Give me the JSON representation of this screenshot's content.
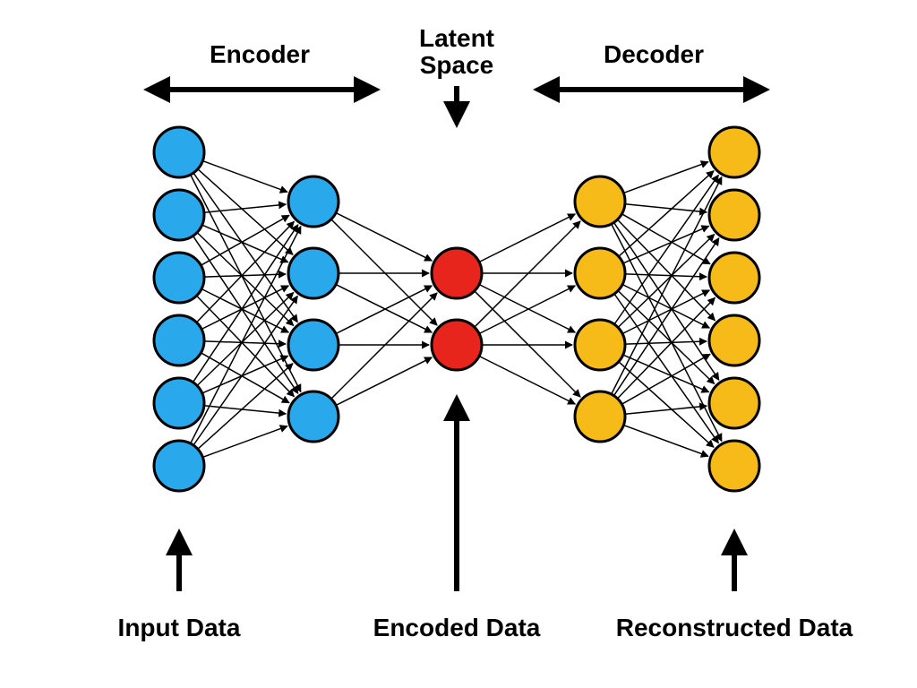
{
  "labels": {
    "encoder": "Encoder",
    "latent_space_line1": "Latent",
    "latent_space_line2": "Space",
    "decoder": "Decoder",
    "input_data": "Input Data",
    "encoded_data": "Encoded Data",
    "reconstructed_data": "Reconstructed Data"
  },
  "colors": {
    "encoder_node": "#2aa8ec",
    "latent_node": "#e8251c",
    "decoder_node": "#f6bb18",
    "arrow": "#000000"
  },
  "architecture": {
    "type": "autoencoder",
    "layers": [
      6,
      4,
      2,
      4,
      6
    ],
    "layer_roles": [
      "input",
      "encoder_hidden",
      "latent",
      "decoder_hidden",
      "output"
    ],
    "fully_connected_between_adjacent_layers": true
  },
  "layout": {
    "node_radius": 28,
    "node_stroke_width": 3,
    "layer_x": [
      200,
      350,
      510,
      670,
      820
    ],
    "layer_centers_y": {
      "6": [
        170,
        240,
        310,
        380,
        450,
        520
      ],
      "4": [
        225,
        305,
        385,
        465
      ],
      "2": [
        305,
        385
      ]
    }
  }
}
